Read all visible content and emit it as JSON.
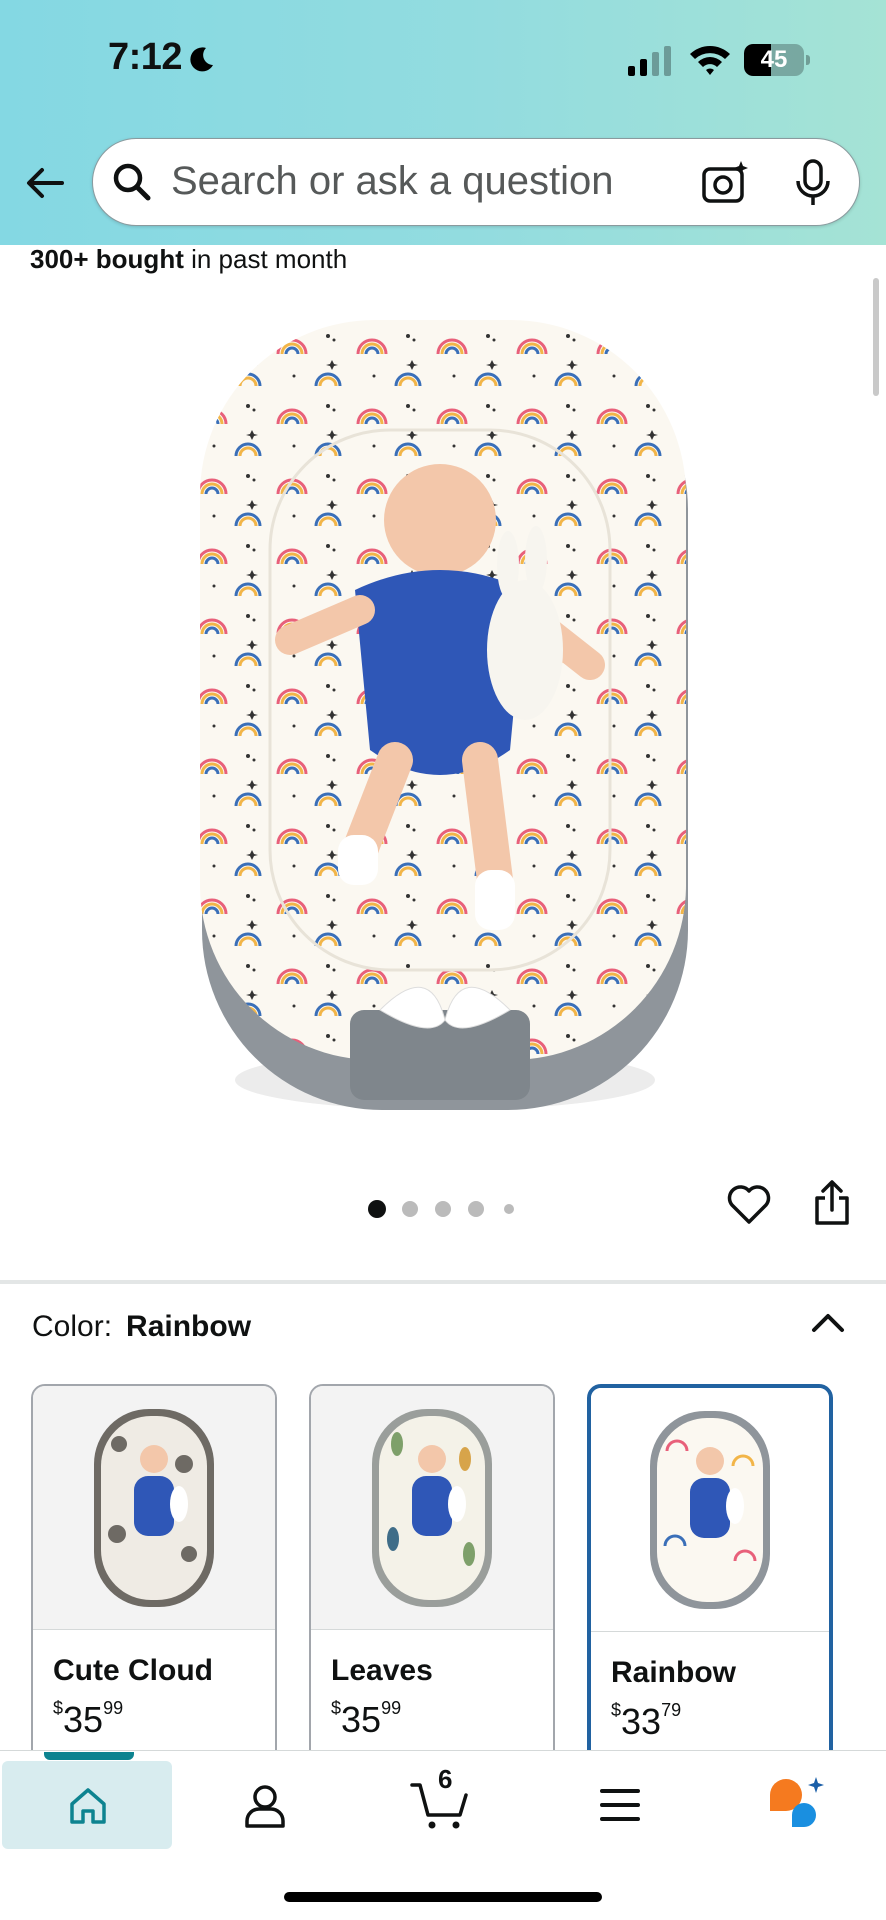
{
  "status_bar": {
    "time": "7:12",
    "battery": "45",
    "battery_level": 0.45
  },
  "search": {
    "placeholder": "Search or ask a question"
  },
  "product": {
    "bought_bold": "300+ bought",
    "bought_rest": " in past month",
    "image_count": 5,
    "current_image": 1
  },
  "color_selector": {
    "label": "Color:",
    "selected": "Rainbow",
    "options": [
      {
        "name": "Cute Cloud",
        "price_symbol": "$",
        "price_whole": "35",
        "price_fraction": "99",
        "selected": false
      },
      {
        "name": "Leaves",
        "price_symbol": "$",
        "price_whole": "35",
        "price_fraction": "99",
        "selected": false
      },
      {
        "name": "Rainbow",
        "price_symbol": "$",
        "price_whole": "33",
        "price_fraction": "79",
        "selected": true
      }
    ]
  },
  "tab_bar": {
    "tabs": [
      "home-icon",
      "account-icon",
      "cart-icon",
      "menu-icon",
      "rufus-assistant-icon"
    ],
    "active": "home-icon",
    "cart_count": "6"
  },
  "colors": {
    "accent": "#0d8390",
    "selected_border": "#2162a1",
    "header_start": "#84d8e3",
    "header_end": "#a5e3d5"
  }
}
